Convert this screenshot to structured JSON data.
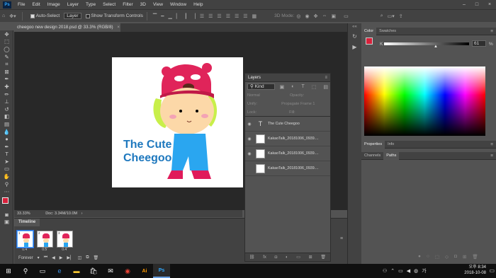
{
  "app": {
    "logo": "Ps"
  },
  "menu": [
    "File",
    "Edit",
    "Image",
    "Layer",
    "Type",
    "Select",
    "Filter",
    "3D",
    "View",
    "Window",
    "Help"
  ],
  "window_controls": [
    "–",
    "□",
    "×"
  ],
  "options_bar": {
    "auto_select_label": "Auto-Select",
    "auto_select_value": "Layer",
    "transform_controls_label": "Show Transform Controls",
    "mode_3d_label": "3D Mode:"
  },
  "document": {
    "tab_title": "cheegoo new design 2018.psd @ 33.3% (RGB/8)",
    "tab_close": "×",
    "artwork_text_line1": "The Cute",
    "artwork_text_line2": "Cheegoo",
    "zoom": "33.33%",
    "doc_size": "Doc: 3.34M/10.0M"
  },
  "timeline": {
    "title": "Timeline",
    "frames": [
      {
        "number": "1",
        "delay": "0.4ˇ"
      },
      {
        "number": "2",
        "delay": "0.5ˇ"
      },
      {
        "number": "3",
        "delay": "0.4ˇ"
      }
    ],
    "loop": "Forever"
  },
  "layers": {
    "title": "Layers",
    "filter_kind": "Kind",
    "blend_mode": "Normal",
    "opacity_label": "Opacity:",
    "unify_label": "Unify:",
    "propagate_label": "Propagate Frame 1",
    "lock_label": "Lock:",
    "fill_label": "Fill:",
    "items": [
      {
        "name": "The Cute Cheegoo",
        "type": "text",
        "visible": true
      },
      {
        "name": "KakaoTalk_20181006_0939....",
        "type": "image",
        "visible": true
      },
      {
        "name": "KakaoTalk_20181006_0939....",
        "type": "image",
        "visible": true
      },
      {
        "name": "KakaoTalk_20181006_0939....",
        "type": "image",
        "visible": false
      }
    ]
  },
  "right_panels": {
    "color_tabs": [
      "Color",
      "Swatches"
    ],
    "k_label": "K",
    "k_value": "61",
    "k_unit": "%",
    "props_tabs": [
      "Properties",
      "Info"
    ],
    "channels_tabs": [
      "Channels",
      "Paths"
    ]
  },
  "taskbar": {
    "time": "오후 8:34",
    "date": "2018-10-08",
    "ime": "가"
  },
  "colors": {
    "accent_red": "#d8213b",
    "artwork_blue": "#1e78be",
    "ps_blue": "#31a8ff"
  }
}
